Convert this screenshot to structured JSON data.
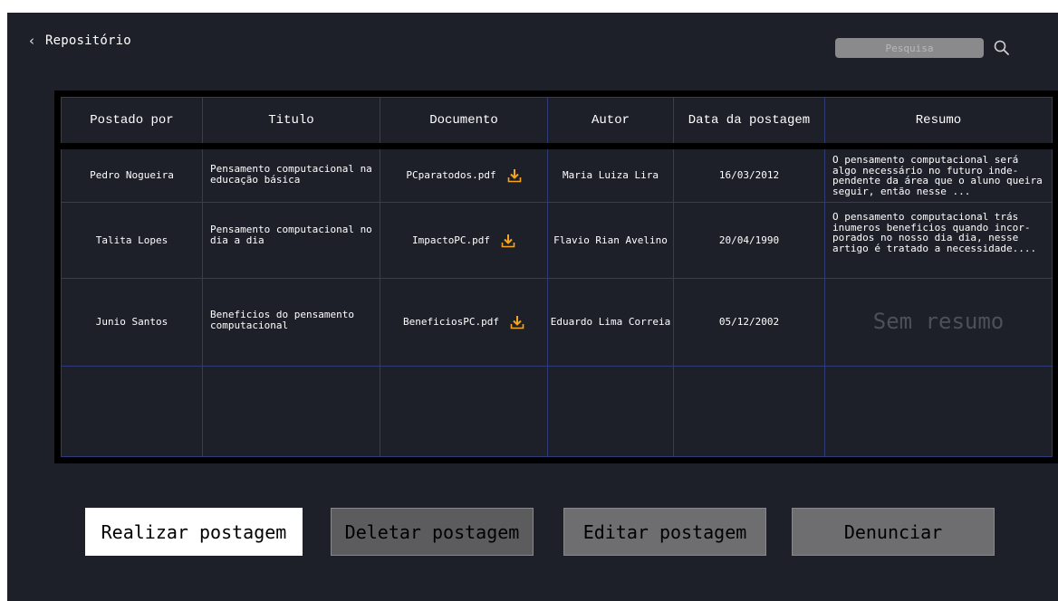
{
  "header": {
    "back_chevron": "‹",
    "title": "Repositório",
    "search_placeholder": "Pesquisa"
  },
  "table": {
    "columns": [
      "Postado por",
      "Titulo",
      "Documento",
      "Autor",
      "Data da postagem",
      "Resumo"
    ],
    "rows": [
      {
        "postado_por": "Pedro Nogueira",
        "titulo": "Pensamento computacional na educação básica",
        "documento": "PCparatodos.pdf",
        "autor": "Maria Luiza Lira",
        "data": "16/03/2012",
        "resumo": "O pensamento computacional será algo necessário no futuro inde-pendente da área que o aluno queira seguir, então nesse ..."
      },
      {
        "postado_por": "Talita Lopes",
        "titulo": "Pensamento computacional no dia a dia",
        "documento": "ImpactoPC.pdf",
        "autor": "Flavio Rian Avelino",
        "data": "20/04/1990",
        "resumo": "O pensamento computacional trás inumeros beneficios quando incor-porados no nosso dia dia, nesse artigo é tratado a necessidade...."
      },
      {
        "postado_por": "Junio Santos",
        "titulo": "Beneficios do pensamento computacional",
        "documento": "BeneficiosPC.pdf",
        "autor": "Eduardo Lima Correia",
        "data": "05/12/2002",
        "resumo": "Sem resumo"
      }
    ]
  },
  "actions": {
    "post": "Realizar postagem",
    "delete": "Deletar postagem",
    "edit": "Editar postagem",
    "report": "Denunciar"
  },
  "colors": {
    "background": "#1e2029",
    "grid_line": "#2f3a78",
    "download_icon": "#f5a51d",
    "placeholder_text": "#4d4f59"
  },
  "icons": {
    "back": "chevron-left-icon",
    "search": "search-icon",
    "download": "download-icon"
  }
}
